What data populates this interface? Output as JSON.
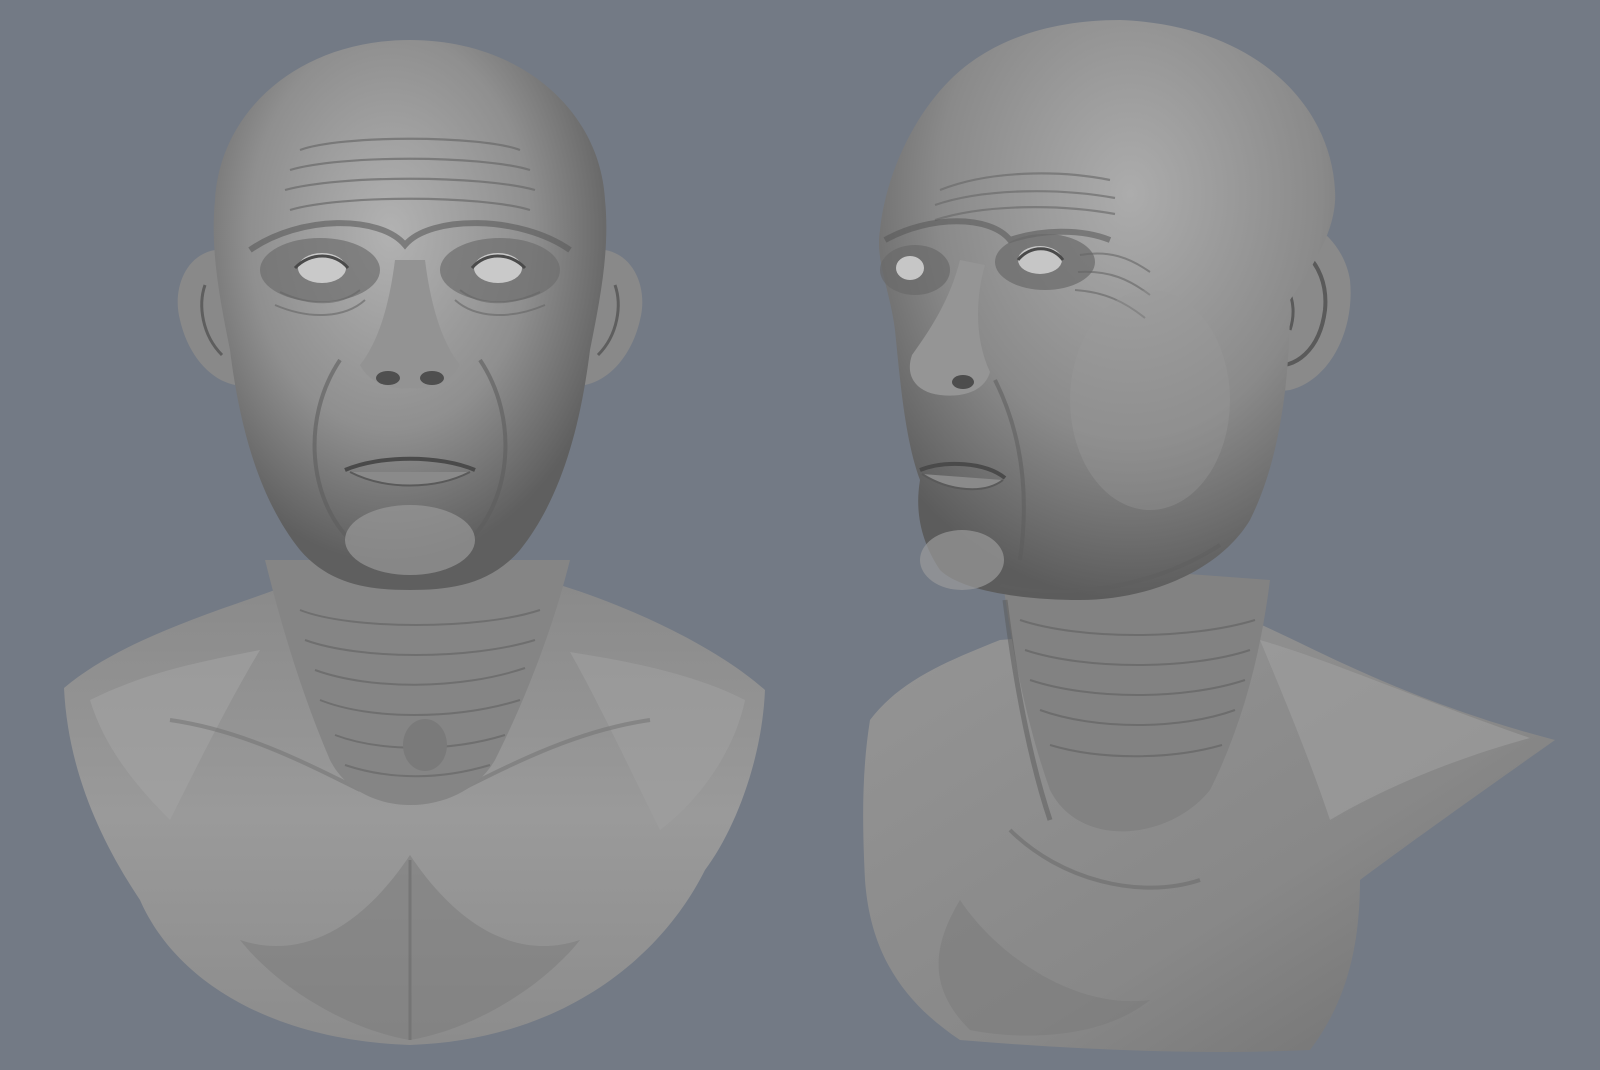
{
  "viewport": {
    "background_color": "#737a85",
    "clay_color": "#8e8e8e",
    "clay_light_color": "#b4b4b4",
    "clay_dark_color": "#4a4a4a"
  },
  "models": [
    {
      "view": "front"
    },
    {
      "view": "three-quarter"
    }
  ]
}
